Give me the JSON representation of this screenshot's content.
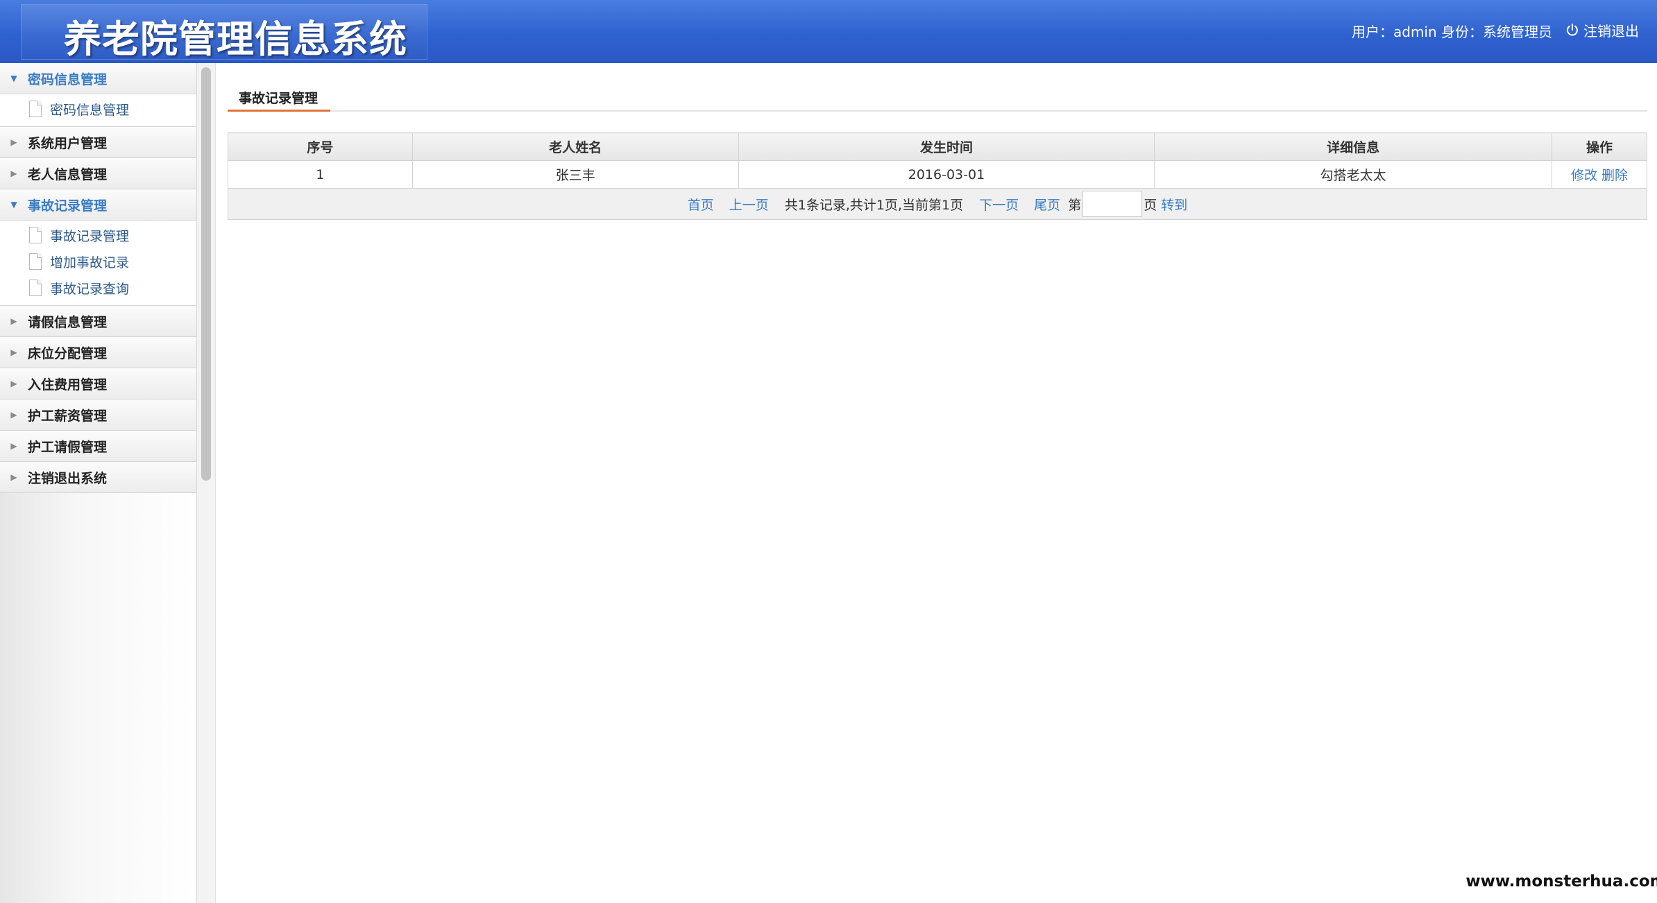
{
  "header": {
    "title": "养老院管理信息系统",
    "user_info": "用户：admin 身份：系统管理员",
    "logout_label": "注销退出"
  },
  "sidebar": {
    "groups": [
      {
        "label": "密码信息管理",
        "open": true,
        "items": [
          {
            "label": "密码信息管理"
          }
        ]
      },
      {
        "label": "系统用户管理",
        "open": false,
        "items": []
      },
      {
        "label": "老人信息管理",
        "open": false,
        "items": []
      },
      {
        "label": "事故记录管理",
        "open": true,
        "items": [
          {
            "label": "事故记录管理"
          },
          {
            "label": "增加事故记录"
          },
          {
            "label": "事故记录查询"
          }
        ]
      },
      {
        "label": "请假信息管理",
        "open": false,
        "items": []
      },
      {
        "label": "床位分配管理",
        "open": false,
        "items": []
      },
      {
        "label": "入住费用管理",
        "open": false,
        "items": []
      },
      {
        "label": "护工薪资管理",
        "open": false,
        "items": []
      },
      {
        "label": "护工请假管理",
        "open": false,
        "items": []
      },
      {
        "label": "注销退出系统",
        "open": false,
        "items": []
      }
    ]
  },
  "main": {
    "tab_label": "事故记录管理",
    "table": {
      "columns": [
        "序号",
        "老人姓名",
        "发生时间",
        "详细信息",
        "操作"
      ],
      "rows": [
        {
          "no": "1",
          "name": "张三丰",
          "time": "2016-03-01",
          "detail": "勾搭老太太",
          "edit": "修改",
          "delete": "删除"
        }
      ]
    },
    "pager": {
      "first": "首页",
      "prev": "上一页",
      "info": "共1条记录,共计1页,当前第1页",
      "next": "下一页",
      "last": "尾页",
      "page_prefix": "第",
      "page_input_value": "",
      "page_suffix": "页",
      "goto": "转到"
    }
  },
  "watermark": "www.monsterhua.com",
  "colors": {
    "header_blue": "#2f62cf",
    "link_blue": "#3a7cc4",
    "tab_accent": "#e2703a"
  }
}
